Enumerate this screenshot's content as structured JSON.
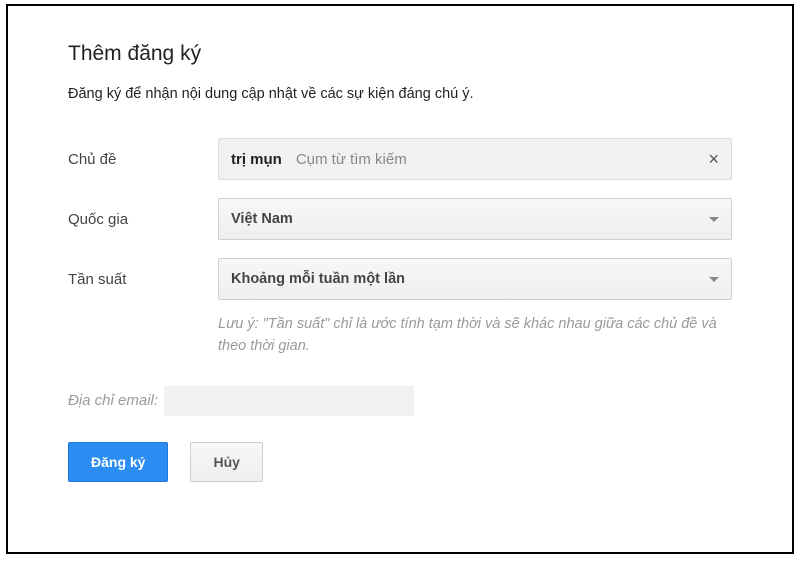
{
  "dialog": {
    "title": "Thêm đăng ký",
    "subtitle": "Đăng ký để nhận nội dung cập nhật về các sự kiện đáng chú ý."
  },
  "form": {
    "topic": {
      "label": "Chủ đề",
      "value": "trị mụn",
      "hint": "Cụm từ tìm kiếm",
      "clear_glyph": "×"
    },
    "country": {
      "label": "Quốc gia",
      "value": "Việt Nam"
    },
    "frequency": {
      "label": "Tần suất",
      "value": "Khoảng mỗi tuần một lần",
      "note": "Lưu ý: \"Tần suất\" chỉ là ước tính tạm thời và sẽ khác nhau giữa các chủ đề và theo thời gian."
    },
    "email": {
      "label": "Địa chỉ email:",
      "value": ""
    }
  },
  "buttons": {
    "submit": "Đăng ký",
    "cancel": "Hủy"
  }
}
